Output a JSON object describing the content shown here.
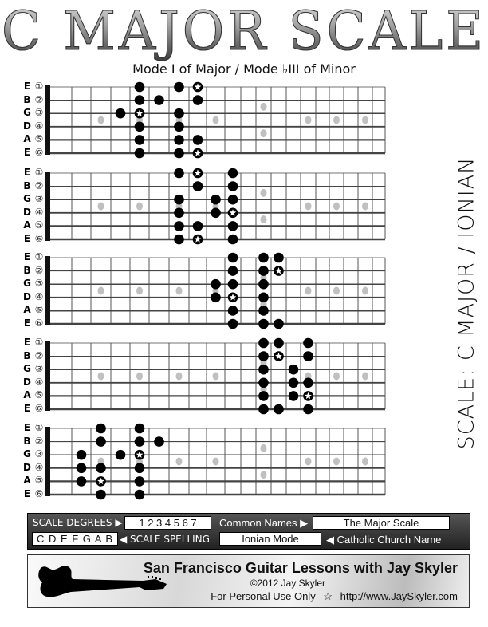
{
  "title": "C MAJOR SCALE",
  "subtitle": "Mode I of Major / Mode ♭III of Minor",
  "vertical_label": "SCALE: C MAJOR / IONIAN",
  "strings": [
    {
      "letter": "E",
      "number": "①"
    },
    {
      "letter": "B",
      "number": "②"
    },
    {
      "letter": "G",
      "number": "③"
    },
    {
      "letter": "D",
      "number": "④"
    },
    {
      "letter": "A",
      "number": "⑤"
    },
    {
      "letter": "E",
      "number": "⑥"
    }
  ],
  "fretboard": {
    "frets": 20,
    "inlay_frets": [
      3,
      5,
      7,
      9,
      15,
      17,
      19
    ],
    "double_inlay_fret": 12,
    "note_color": "#000000",
    "inlay_color": "#c0c0c0"
  },
  "patterns": [
    {
      "notes": [
        [
          5,
          7,
          8
        ],
        [
          5,
          6,
          8
        ],
        [
          4,
          5,
          7
        ],
        [
          5,
          7
        ],
        [
          5,
          7,
          8
        ],
        [
          5,
          7,
          8
        ]
      ],
      "roots": [
        [
          8
        ],
        [],
        [
          5
        ],
        [],
        [],
        [
          8
        ]
      ]
    },
    {
      "notes": [
        [
          7,
          8,
          10
        ],
        [
          8,
          10
        ],
        [
          7,
          9,
          10
        ],
        [
          7,
          9,
          10
        ],
        [
          7,
          8,
          10
        ],
        [
          7,
          8,
          10
        ]
      ],
      "roots": [
        [
          8
        ],
        [],
        [],
        [
          10
        ],
        [],
        [
          8
        ]
      ]
    },
    {
      "notes": [
        [
          10,
          12,
          13
        ],
        [
          10,
          12,
          13
        ],
        [
          9,
          10,
          12
        ],
        [
          9,
          10,
          12
        ],
        [
          10,
          12
        ],
        [
          10,
          12,
          13
        ]
      ],
      "roots": [
        [],
        [
          13
        ],
        [],
        [
          10
        ],
        [],
        []
      ]
    },
    {
      "notes": [
        [
          12,
          13,
          15
        ],
        [
          12,
          13,
          15
        ],
        [
          12,
          14
        ],
        [
          12,
          14,
          15
        ],
        [
          12,
          14,
          15
        ],
        [
          12,
          13,
          15
        ]
      ],
      "roots": [
        [],
        [
          13
        ],
        [],
        [],
        [
          15
        ],
        []
      ]
    },
    {
      "notes": [
        [
          3,
          5
        ],
        [
          3,
          5,
          6
        ],
        [
          2,
          4,
          5
        ],
        [
          2,
          3,
          5
        ],
        [
          2,
          3,
          5
        ],
        [
          3,
          5
        ]
      ],
      "roots": [
        [],
        [],
        [
          5
        ],
        [],
        [
          3
        ],
        []
      ]
    }
  ],
  "info": {
    "scale_degrees_label": "SCALE DEGREES ▶",
    "scale_degrees": "1 2 3 4 5 6 7",
    "scale_spelling": "C D E F G A B",
    "scale_spelling_label": "◀ SCALE SPELLING",
    "common_names_label": "Common Names ▶",
    "common_name": "The Major Scale",
    "church_name": "Ionian Mode",
    "church_name_label": "◀ Catholic Church Name"
  },
  "footer": {
    "heading": "San Francisco Guitar Lessons with Jay Skyler",
    "copyright": "©2012 Jay Skyler",
    "usage": "For Personal Use Only",
    "star": "☆",
    "url": "http://www.JaySkyler.com"
  }
}
